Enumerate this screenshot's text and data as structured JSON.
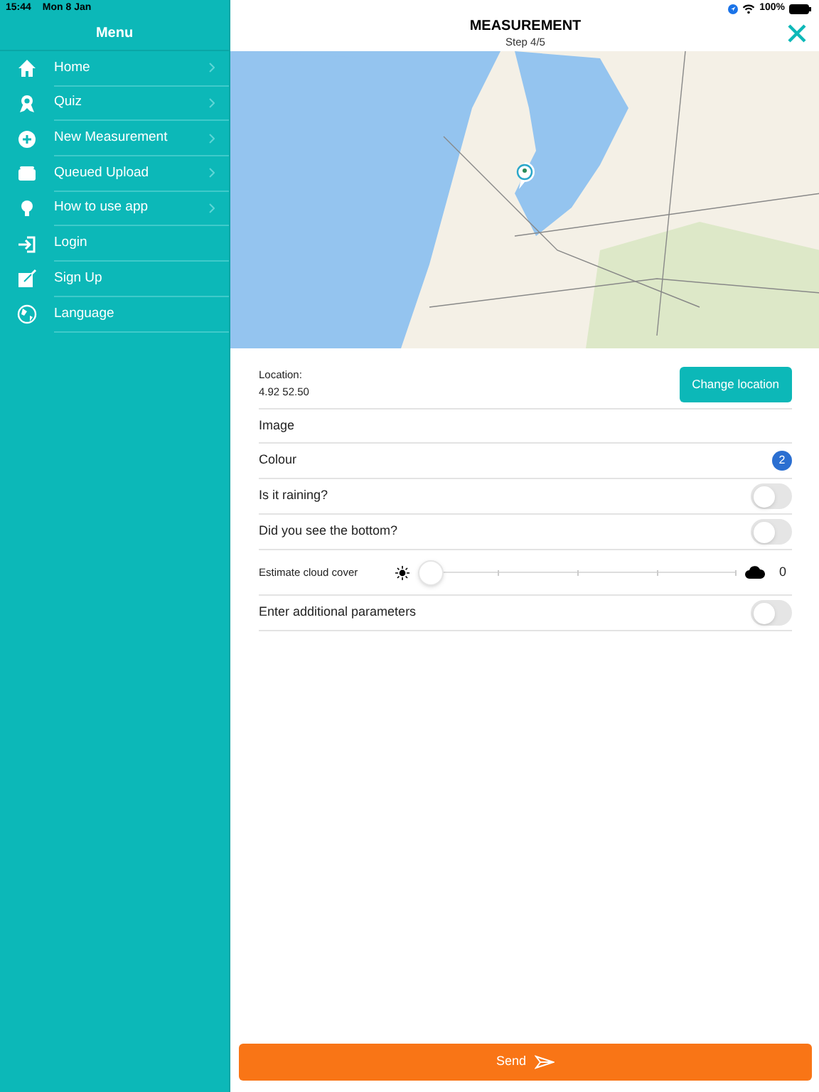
{
  "status_bar": {
    "time": "15:44",
    "date": "Mon 8 Jan",
    "battery": "100%"
  },
  "menu": {
    "title": "Menu",
    "items": [
      {
        "label": "Home",
        "has_arrow": true
      },
      {
        "label": "Quiz",
        "has_arrow": true
      },
      {
        "label": "New Measurement",
        "has_arrow": true
      },
      {
        "label": "Queued Upload",
        "has_arrow": true
      },
      {
        "label": "How to use app",
        "has_arrow": true
      },
      {
        "label": "Login",
        "has_arrow": false
      },
      {
        "label": "Sign Up",
        "has_arrow": false
      },
      {
        "label": "Language",
        "has_arrow": false
      }
    ]
  },
  "header": {
    "title": "MEASUREMENT",
    "subtitle": "Step 4/5"
  },
  "form": [
    {
      "kind": "location",
      "label": "Location:",
      "value": "4.92 52.50",
      "button": "Change location"
    },
    {
      "kind": "plain",
      "label": "Image"
    },
    {
      "kind": "badge",
      "label": "Colour",
      "badge": "2"
    },
    {
      "kind": "toggle",
      "label": "Is it raining?",
      "on": false
    },
    {
      "kind": "toggle",
      "label": "Did you see the bottom?",
      "on": false
    },
    {
      "kind": "slider",
      "label": "Estimate cloud cover",
      "level": 0,
      "reading": "0"
    },
    {
      "kind": "toggle",
      "label": "Enter additional parameters",
      "on": false
    }
  ],
  "send_button": "Send"
}
